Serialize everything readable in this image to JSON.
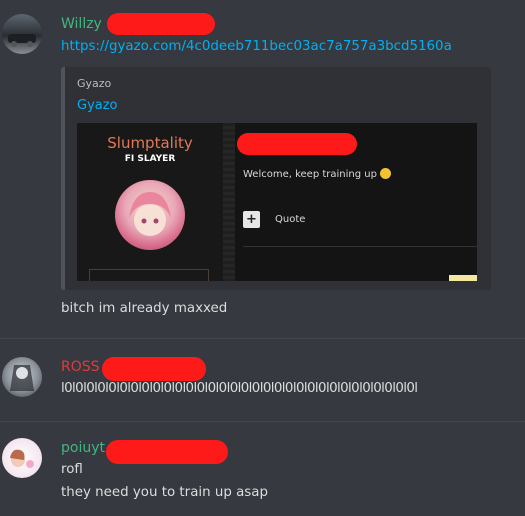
{
  "messages": [
    {
      "username": "Willzy",
      "username_color": "#43b581",
      "link": "https://gyazo.com/4c0deeb711bec03ac7a757a3bcd5160a",
      "embed": {
        "provider": "Gyazo",
        "title": "Gyazo",
        "image": {
          "profile_name": "Slumptality",
          "profile_title": "FI SLAYER",
          "welcome": "Welcome, keep training up",
          "plus": "+",
          "quote": "Quote"
        }
      },
      "text": "bitch im already maxxed"
    },
    {
      "username": "ROSS",
      "username_color": "#e03b3b",
      "text": "l0l0l0l0l0l0l0l0l0l0l0l0l0l0l0l0l0l0l0l0l0l0l0l0l0l0l0l0l0l0l0l0l"
    },
    {
      "username": "poiuyt",
      "username_color": "#43b581",
      "lines": [
        "rofl",
        "they need you to train up asap"
      ]
    }
  ]
}
